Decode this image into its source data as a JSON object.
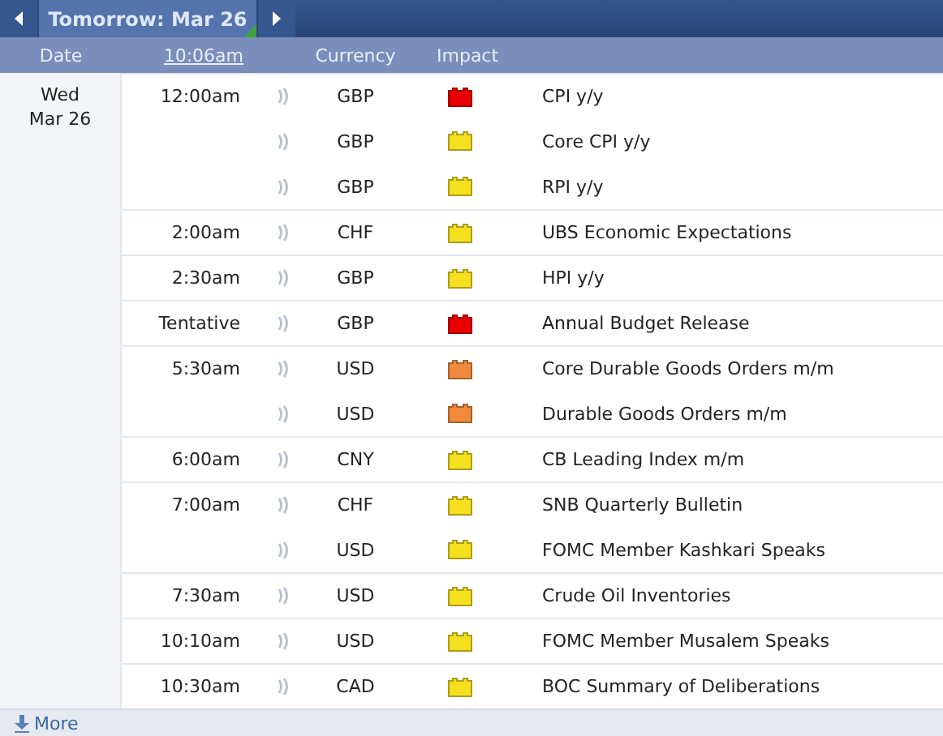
{
  "nav": {
    "title": "Tomorrow: Mar 26"
  },
  "header": {
    "date": "Date",
    "time": "10:06am",
    "currency": "Currency",
    "impact": "Impact"
  },
  "day": {
    "weekday": "Wed",
    "date": "Mar 26"
  },
  "events": [
    {
      "time": "12:00am",
      "currency": "GBP",
      "color": "#e80000",
      "event": "CPI y/y"
    },
    {
      "currency": "GBP",
      "color": "#f5e020",
      "event": "Core CPI y/y"
    },
    {
      "currency": "GBP",
      "color": "#f5e020",
      "event": "RPI y/y"
    },
    {
      "time": "2:00am",
      "currency": "CHF",
      "color": "#f5e020",
      "event": "UBS Economic Expectations"
    },
    {
      "time": "2:30am",
      "currency": "GBP",
      "color": "#f5e020",
      "event": "HPI y/y"
    },
    {
      "time": "Tentative",
      "currency": "GBP",
      "color": "#e80000",
      "event": "Annual Budget Release"
    },
    {
      "time": "5:30am",
      "currency": "USD",
      "color": "#f08a3c",
      "event": "Core Durable Goods Orders m/m"
    },
    {
      "currency": "USD",
      "color": "#f08a3c",
      "event": "Durable Goods Orders m/m"
    },
    {
      "time": "6:00am",
      "currency": "CNY",
      "color": "#f5e020",
      "event": "CB Leading Index m/m"
    },
    {
      "time": "7:00am",
      "currency": "CHF",
      "color": "#f5e020",
      "event": "SNB Quarterly Bulletin"
    },
    {
      "currency": "USD",
      "color": "#f5e020",
      "event": "FOMC Member Kashkari Speaks"
    },
    {
      "time": "7:30am",
      "currency": "USD",
      "color": "#f5e020",
      "event": "Crude Oil Inventories"
    },
    {
      "time": "10:10am",
      "currency": "USD",
      "color": "#f5e020",
      "event": "FOMC Member Musalem Speaks"
    },
    {
      "time": "10:30am",
      "currency": "CAD",
      "color": "#f5e020",
      "event": "BOC Summary of Deliberations"
    }
  ],
  "footer": {
    "more": "More"
  }
}
